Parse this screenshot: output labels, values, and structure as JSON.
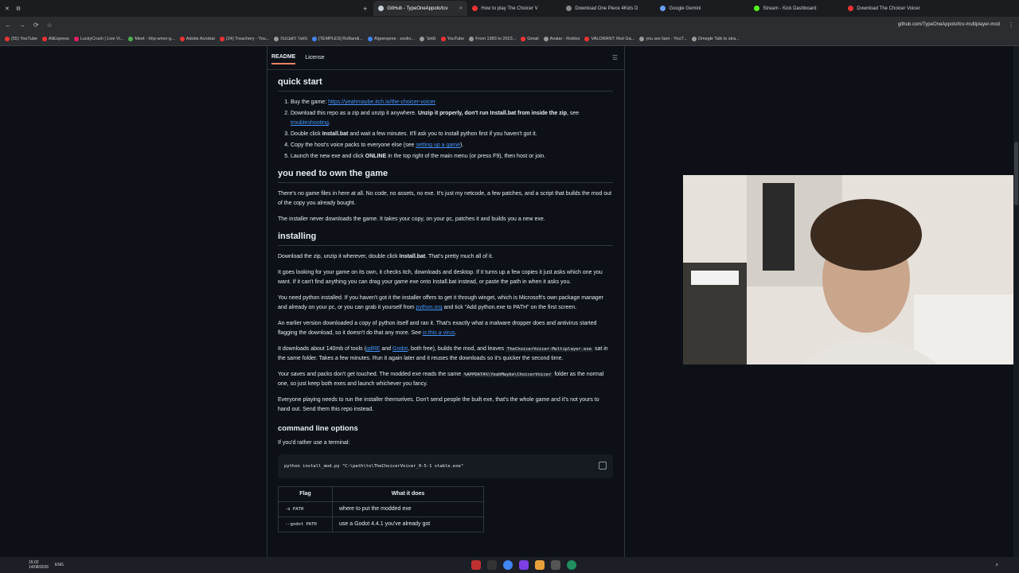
{
  "browser": {
    "tabs": [
      {
        "label": "GitHub - TypeOneAppolo/tcv",
        "active": true
      },
      {
        "label": "How to play The Choicer V",
        "active": false
      },
      {
        "label": "Download One Piece 4Kids D",
        "active": false
      },
      {
        "label": "Google Gemini",
        "active": false
      },
      {
        "label": "Stream - Kick Dashboard",
        "active": false
      },
      {
        "label": "Download The Choicer Voicer",
        "active": false
      }
    ],
    "url": "github.com/TypeOneAppolo/tcv-multiplayer-mod",
    "bookmarks": [
      "(55) YouTube",
      "AliExpress",
      "LuckyCrush | Live Vi...",
      "Meet - hhp-wnvn-g...",
      "Adobe Acrobat",
      "(24) Treachery - You...",
      "מאגר חשבונות",
      "[TEMPLES] RoBandi...",
      "Algoexpres - sxolio...",
      "מאגר",
      "YouTube",
      "From 1983 to 2023...",
      "Gmail",
      "Avatar - Roblox",
      "VALORANT: Riot Ga...",
      "you are liam - YouT...",
      "Omegle Talk to stra..."
    ]
  },
  "readme": {
    "tabs": [
      "README",
      "License"
    ],
    "quick_start": {
      "title": "quick start",
      "items": [
        {
          "pre": "Buy the game: ",
          "link": "https://yeahmaybe.itch.io/the-choicer-voicer",
          "post": ""
        },
        {
          "pre": "Download this repo as a zip and unzip it anywhere. ",
          "bold": "Unzip it properly, don't run Install.bat from inside the zip",
          "post": ", see ",
          "link": "troubleshooting",
          "tail": "."
        },
        {
          "pre": "Double click ",
          "bold": "Install.bat",
          "post": " and wait a few minutes. It'll ask you to install python first if you haven't got it."
        },
        {
          "pre": "Copy the host's voice packs to everyone else (see ",
          "link": "setting up a game",
          "post": ")."
        },
        {
          "pre": "Launch the new exe and click ",
          "bold": "ONLINE",
          "post": " in the top right of the main menu (or press F9), then host or join."
        }
      ]
    },
    "own_game": {
      "title": "you need to own the game",
      "p1": "There's no game files in here at all. No code, no assets, no exe. It's just my netcode, a few patches, and a script that builds the mod out of the copy you already bought.",
      "p2": "The installer never downloads the game. It takes your copy, on your pc, patches it and builds you a new exe."
    },
    "installing": {
      "title": "installing",
      "p1_pre": "Download the zip, unzip it wherever, double click ",
      "p1_bold": "Install.bat",
      "p1_post": ". That's pretty much all of it.",
      "p2": "It goes looking for your game on its own, it checks itch, downloads and desktop. If it turns up a few copies it just asks which one you want. If it can't find anything you can drag your game exe onto Install.bat instead, or paste the path in when it asks you.",
      "p3_pre": "You need python installed. If you haven't got it the installer offers to get it through winget, which is Microsoft's own package manager and already on your pc, or you can grab it yourself from ",
      "p3_link": "python.org",
      "p3_post": " and tick \"Add python.exe to PATH\" on the first screen.",
      "p4_pre": "An earlier version downloaded a copy of python itself and ran it. That's exactly what a malware dropper does and antivirus started flagging the download, so it doesn't do that any more. See ",
      "p4_link": "is this a virus",
      "p4_post": ".",
      "p5_pre": "It downloads about 140mb of tools (",
      "p5_link1": "gdRE",
      "p5_mid": " and ",
      "p5_link2": "Godot",
      "p5_mid2": ", both free), builds the mod, and leaves ",
      "p5_code": "TheChoicerVoicer-Multiplayer.exe",
      "p5_post": " sat in the same folder. Takes a few minutes. Run it again later and it reuses the downloads so it's quicker the second time.",
      "p6_pre": "Your saves and packs don't get touched. The modded exe reads the same ",
      "p6_code": "%APPDATA%\\YeahMaybe\\ChoicerVoicer",
      "p6_post": " folder as the normal one, so just keep both exes and launch whichever you fancy.",
      "p7": "Everyone playing needs to run the installer themselves. Don't send people the built exe, that's the whole game and it's not yours to hand out. Send them this repo instead."
    },
    "cmd": {
      "title": "command line options",
      "intro": "If you'd rather use a terminal:",
      "code": "python install_mod.py \"C:\\path\\to\\TheChoicerVoicer_0-5-1 stable.exe\"",
      "headers": [
        "Flag",
        "What it does"
      ],
      "rows": [
        [
          "-o PATH",
          "where to put the modded exe"
        ],
        [
          "--godot PATH",
          "use a Godot 4.4.1 you've already got"
        ]
      ]
    }
  },
  "taskbar": {
    "time": "15:02",
    "date": "14/08/2026",
    "lang": "ENG"
  }
}
